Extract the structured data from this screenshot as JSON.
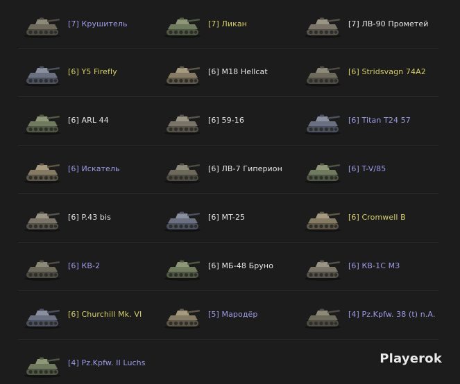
{
  "colors": {
    "premium": "#d8cf6a",
    "standard": "#e6e6e6",
    "collector": "#9e9ce8",
    "background": "#1c1c1c",
    "divider": "#2b2b2b"
  },
  "tanks": [
    {
      "name": "[7] Крушитель",
      "type": "collector",
      "icon": "tank-icon"
    },
    {
      "name": "[7] Ликан",
      "type": "premium",
      "icon": "tank-icon"
    },
    {
      "name": "[7] ЛВ-90 Прометей",
      "type": "standard",
      "icon": "tank-icon"
    },
    {
      "name": "[6] Y5 Firefly",
      "type": "premium",
      "icon": "tank-icon"
    },
    {
      "name": "[6] M18 Hellcat",
      "type": "standard",
      "icon": "tank-icon"
    },
    {
      "name": "[6] Stridsvagn 74A2",
      "type": "premium",
      "icon": "tank-icon"
    },
    {
      "name": "[6] ARL 44",
      "type": "standard",
      "icon": "tank-icon"
    },
    {
      "name": "[6] 59-16",
      "type": "standard",
      "icon": "tank-icon"
    },
    {
      "name": "[6] Titan T24 57",
      "type": "collector",
      "icon": "tank-icon"
    },
    {
      "name": "[6] Искатель",
      "type": "collector",
      "icon": "tank-icon"
    },
    {
      "name": "[6] ЛВ-7 Гиперион",
      "type": "standard",
      "icon": "tank-icon"
    },
    {
      "name": "[6] T-V/85",
      "type": "collector",
      "icon": "tank-icon"
    },
    {
      "name": "[6] P.43 bis",
      "type": "standard",
      "icon": "tank-icon"
    },
    {
      "name": "[6] MT-25",
      "type": "standard",
      "icon": "tank-icon"
    },
    {
      "name": "[6] Cromwell B",
      "type": "premium",
      "icon": "tank-icon"
    },
    {
      "name": "[6] КВ-2",
      "type": "collector",
      "icon": "tank-icon"
    },
    {
      "name": "[6] МБ-48 Бруно",
      "type": "standard",
      "icon": "tank-icon"
    },
    {
      "name": "[6] КВ-1С МЗ",
      "type": "collector",
      "icon": "tank-icon"
    },
    {
      "name": "[6] Churchill Mk. VI",
      "type": "premium",
      "icon": "tank-icon"
    },
    {
      "name": "[5] Мародёр",
      "type": "collector",
      "icon": "tank-icon"
    },
    {
      "name": "[4] Pz.Kpfw. 38 (t) n.A.",
      "type": "collector",
      "icon": "tank-icon"
    },
    {
      "name": "[4] Pz.Kpfw. II Luchs",
      "type": "collector",
      "icon": "tank-icon"
    }
  ],
  "watermark": "Playerok"
}
